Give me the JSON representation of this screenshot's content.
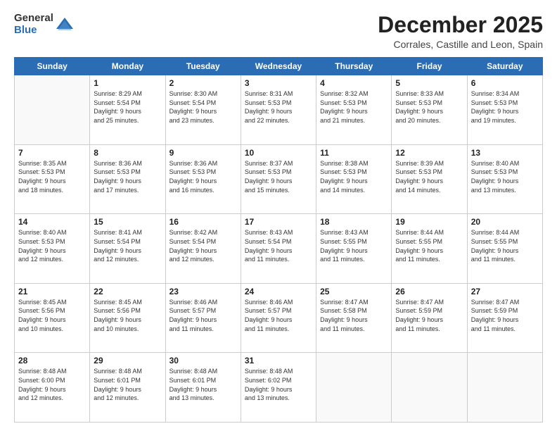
{
  "logo": {
    "general": "General",
    "blue": "Blue"
  },
  "header": {
    "month": "December 2025",
    "location": "Corrales, Castille and Leon, Spain"
  },
  "weekdays": [
    "Sunday",
    "Monday",
    "Tuesday",
    "Wednesday",
    "Thursday",
    "Friday",
    "Saturday"
  ],
  "weeks": [
    [
      {
        "day": "",
        "info": ""
      },
      {
        "day": "1",
        "info": "Sunrise: 8:29 AM\nSunset: 5:54 PM\nDaylight: 9 hours\nand 25 minutes."
      },
      {
        "day": "2",
        "info": "Sunrise: 8:30 AM\nSunset: 5:54 PM\nDaylight: 9 hours\nand 23 minutes."
      },
      {
        "day": "3",
        "info": "Sunrise: 8:31 AM\nSunset: 5:53 PM\nDaylight: 9 hours\nand 22 minutes."
      },
      {
        "day": "4",
        "info": "Sunrise: 8:32 AM\nSunset: 5:53 PM\nDaylight: 9 hours\nand 21 minutes."
      },
      {
        "day": "5",
        "info": "Sunrise: 8:33 AM\nSunset: 5:53 PM\nDaylight: 9 hours\nand 20 minutes."
      },
      {
        "day": "6",
        "info": "Sunrise: 8:34 AM\nSunset: 5:53 PM\nDaylight: 9 hours\nand 19 minutes."
      }
    ],
    [
      {
        "day": "7",
        "info": "Sunrise: 8:35 AM\nSunset: 5:53 PM\nDaylight: 9 hours\nand 18 minutes."
      },
      {
        "day": "8",
        "info": "Sunrise: 8:36 AM\nSunset: 5:53 PM\nDaylight: 9 hours\nand 17 minutes."
      },
      {
        "day": "9",
        "info": "Sunrise: 8:36 AM\nSunset: 5:53 PM\nDaylight: 9 hours\nand 16 minutes."
      },
      {
        "day": "10",
        "info": "Sunrise: 8:37 AM\nSunset: 5:53 PM\nDaylight: 9 hours\nand 15 minutes."
      },
      {
        "day": "11",
        "info": "Sunrise: 8:38 AM\nSunset: 5:53 PM\nDaylight: 9 hours\nand 14 minutes."
      },
      {
        "day": "12",
        "info": "Sunrise: 8:39 AM\nSunset: 5:53 PM\nDaylight: 9 hours\nand 14 minutes."
      },
      {
        "day": "13",
        "info": "Sunrise: 8:40 AM\nSunset: 5:53 PM\nDaylight: 9 hours\nand 13 minutes."
      }
    ],
    [
      {
        "day": "14",
        "info": "Sunrise: 8:40 AM\nSunset: 5:53 PM\nDaylight: 9 hours\nand 12 minutes."
      },
      {
        "day": "15",
        "info": "Sunrise: 8:41 AM\nSunset: 5:54 PM\nDaylight: 9 hours\nand 12 minutes."
      },
      {
        "day": "16",
        "info": "Sunrise: 8:42 AM\nSunset: 5:54 PM\nDaylight: 9 hours\nand 12 minutes."
      },
      {
        "day": "17",
        "info": "Sunrise: 8:43 AM\nSunset: 5:54 PM\nDaylight: 9 hours\nand 11 minutes."
      },
      {
        "day": "18",
        "info": "Sunrise: 8:43 AM\nSunset: 5:55 PM\nDaylight: 9 hours\nand 11 minutes."
      },
      {
        "day": "19",
        "info": "Sunrise: 8:44 AM\nSunset: 5:55 PM\nDaylight: 9 hours\nand 11 minutes."
      },
      {
        "day": "20",
        "info": "Sunrise: 8:44 AM\nSunset: 5:55 PM\nDaylight: 9 hours\nand 11 minutes."
      }
    ],
    [
      {
        "day": "21",
        "info": "Sunrise: 8:45 AM\nSunset: 5:56 PM\nDaylight: 9 hours\nand 10 minutes."
      },
      {
        "day": "22",
        "info": "Sunrise: 8:45 AM\nSunset: 5:56 PM\nDaylight: 9 hours\nand 10 minutes."
      },
      {
        "day": "23",
        "info": "Sunrise: 8:46 AM\nSunset: 5:57 PM\nDaylight: 9 hours\nand 11 minutes."
      },
      {
        "day": "24",
        "info": "Sunrise: 8:46 AM\nSunset: 5:57 PM\nDaylight: 9 hours\nand 11 minutes."
      },
      {
        "day": "25",
        "info": "Sunrise: 8:47 AM\nSunset: 5:58 PM\nDaylight: 9 hours\nand 11 minutes."
      },
      {
        "day": "26",
        "info": "Sunrise: 8:47 AM\nSunset: 5:59 PM\nDaylight: 9 hours\nand 11 minutes."
      },
      {
        "day": "27",
        "info": "Sunrise: 8:47 AM\nSunset: 5:59 PM\nDaylight: 9 hours\nand 11 minutes."
      }
    ],
    [
      {
        "day": "28",
        "info": "Sunrise: 8:48 AM\nSunset: 6:00 PM\nDaylight: 9 hours\nand 12 minutes."
      },
      {
        "day": "29",
        "info": "Sunrise: 8:48 AM\nSunset: 6:01 PM\nDaylight: 9 hours\nand 12 minutes."
      },
      {
        "day": "30",
        "info": "Sunrise: 8:48 AM\nSunset: 6:01 PM\nDaylight: 9 hours\nand 13 minutes."
      },
      {
        "day": "31",
        "info": "Sunrise: 8:48 AM\nSunset: 6:02 PM\nDaylight: 9 hours\nand 13 minutes."
      },
      {
        "day": "",
        "info": ""
      },
      {
        "day": "",
        "info": ""
      },
      {
        "day": "",
        "info": ""
      }
    ]
  ]
}
